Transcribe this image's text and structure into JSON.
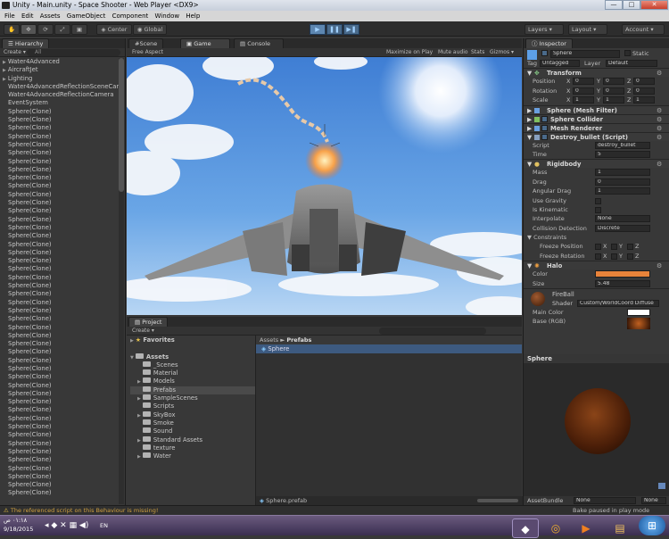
{
  "window": {
    "title": "Unity - Main.unity - Space Shooter - Web Player <DX9>",
    "minimize": "—",
    "maximize": "□",
    "close": "✕"
  },
  "menu": [
    "File",
    "Edit",
    "Assets",
    "GameObject",
    "Component",
    "Window",
    "Help"
  ],
  "toolbar": {
    "center": "Center",
    "global": "Global",
    "layers": "Layers",
    "layout": "Layout",
    "account": "Account"
  },
  "hierarchy": {
    "tab": "Hierarchy",
    "create": "Create",
    "search": "All",
    "items": [
      "Water4Advanced",
      "AircraftJet",
      "Lighting",
      "Water4AdvancedReflectionSceneCar",
      "Water4AdvancedReflectionCamera",
      "EventSystem"
    ],
    "clone_label": "Sphere(Clone)"
  },
  "scene_tabs": {
    "scene": "Scene",
    "game": "Game",
    "console": "Console"
  },
  "game_bar": {
    "aspect": "Free Aspect",
    "maximize": "Maximize on Play",
    "mute": "Mute audio",
    "stats": "Stats",
    "gizmos": "Gizmos"
  },
  "project": {
    "tab": "Project",
    "create": "Create",
    "favorites": "Favorites",
    "assets": "Assets",
    "folders": [
      "_Scenes",
      "Material",
      "Models",
      "Prefabs",
      "SampleScenes",
      "Scripts",
      "SkyBox",
      "Smoke",
      "Sound",
      "Standard Assets",
      "texture",
      "Water"
    ],
    "breadcrumb_root": "Assets",
    "breadcrumb_sep": "►",
    "breadcrumb_current": "Prefabs",
    "file": "Sphere",
    "bottom_file": "Sphere.prefab"
  },
  "inspector": {
    "tab": "Inspector",
    "name": "Sphere",
    "static": "Static",
    "tag_label": "Tag",
    "tag": "Untagged",
    "layer_label": "Layer",
    "layer": "Default",
    "transform": {
      "title": "Transform",
      "rows": [
        {
          "label": "Position",
          "x": "0",
          "y": "0",
          "z": "0"
        },
        {
          "label": "Rotation",
          "x": "0",
          "y": "0",
          "z": "0"
        },
        {
          "label": "Scale",
          "x": "1",
          "y": "1",
          "z": "1"
        }
      ]
    },
    "components": [
      "Sphere (Mesh Filter)",
      "Sphere Collider",
      "Mesh Renderer",
      "Destroy_bullet (Script)"
    ],
    "script": {
      "label": "Script",
      "value": "destroy_bullet",
      "time_label": "Time",
      "time": "5"
    },
    "rigidbody": {
      "title": "Rigidbody",
      "mass_label": "Mass",
      "mass": "1",
      "drag_label": "Drag",
      "drag": "0",
      "angular_label": "Angular Drag",
      "angular": "1",
      "gravity": "Use Gravity",
      "kinematic": "Is Kinematic",
      "interp_label": "Interpolate",
      "interp": "None",
      "collision_label": "Collision Detection",
      "collision": "Discrete",
      "constraints": "Constraints",
      "freeze_pos": "Freeze Position",
      "freeze_rot": "Freeze Rotation"
    },
    "halo": {
      "title": "Halo",
      "color_label": "Color",
      "size_label": "Size",
      "size": "5.48",
      "color": "#e8833a"
    },
    "material": {
      "name": "FireBall",
      "shader_label": "Shader",
      "shader": "Custom/WorldCoord Diffuse",
      "main_color": "Main Color",
      "base": "Base (RGB)"
    },
    "preview_title": "Sphere",
    "assetbundle_label": "AssetBundle",
    "assetbundle": "None",
    "assetbundle2": "None"
  },
  "status": {
    "warning": "The referenced script on this Behaviour is missing!",
    "paused": "Bake paused in play mode"
  },
  "taskbar": {
    "time": "٠١:١٨ ص",
    "date": "9/18/2015",
    "lang": "EN"
  },
  "colors": {
    "accent": "#4a6a8a",
    "halo": "#e8833a"
  }
}
